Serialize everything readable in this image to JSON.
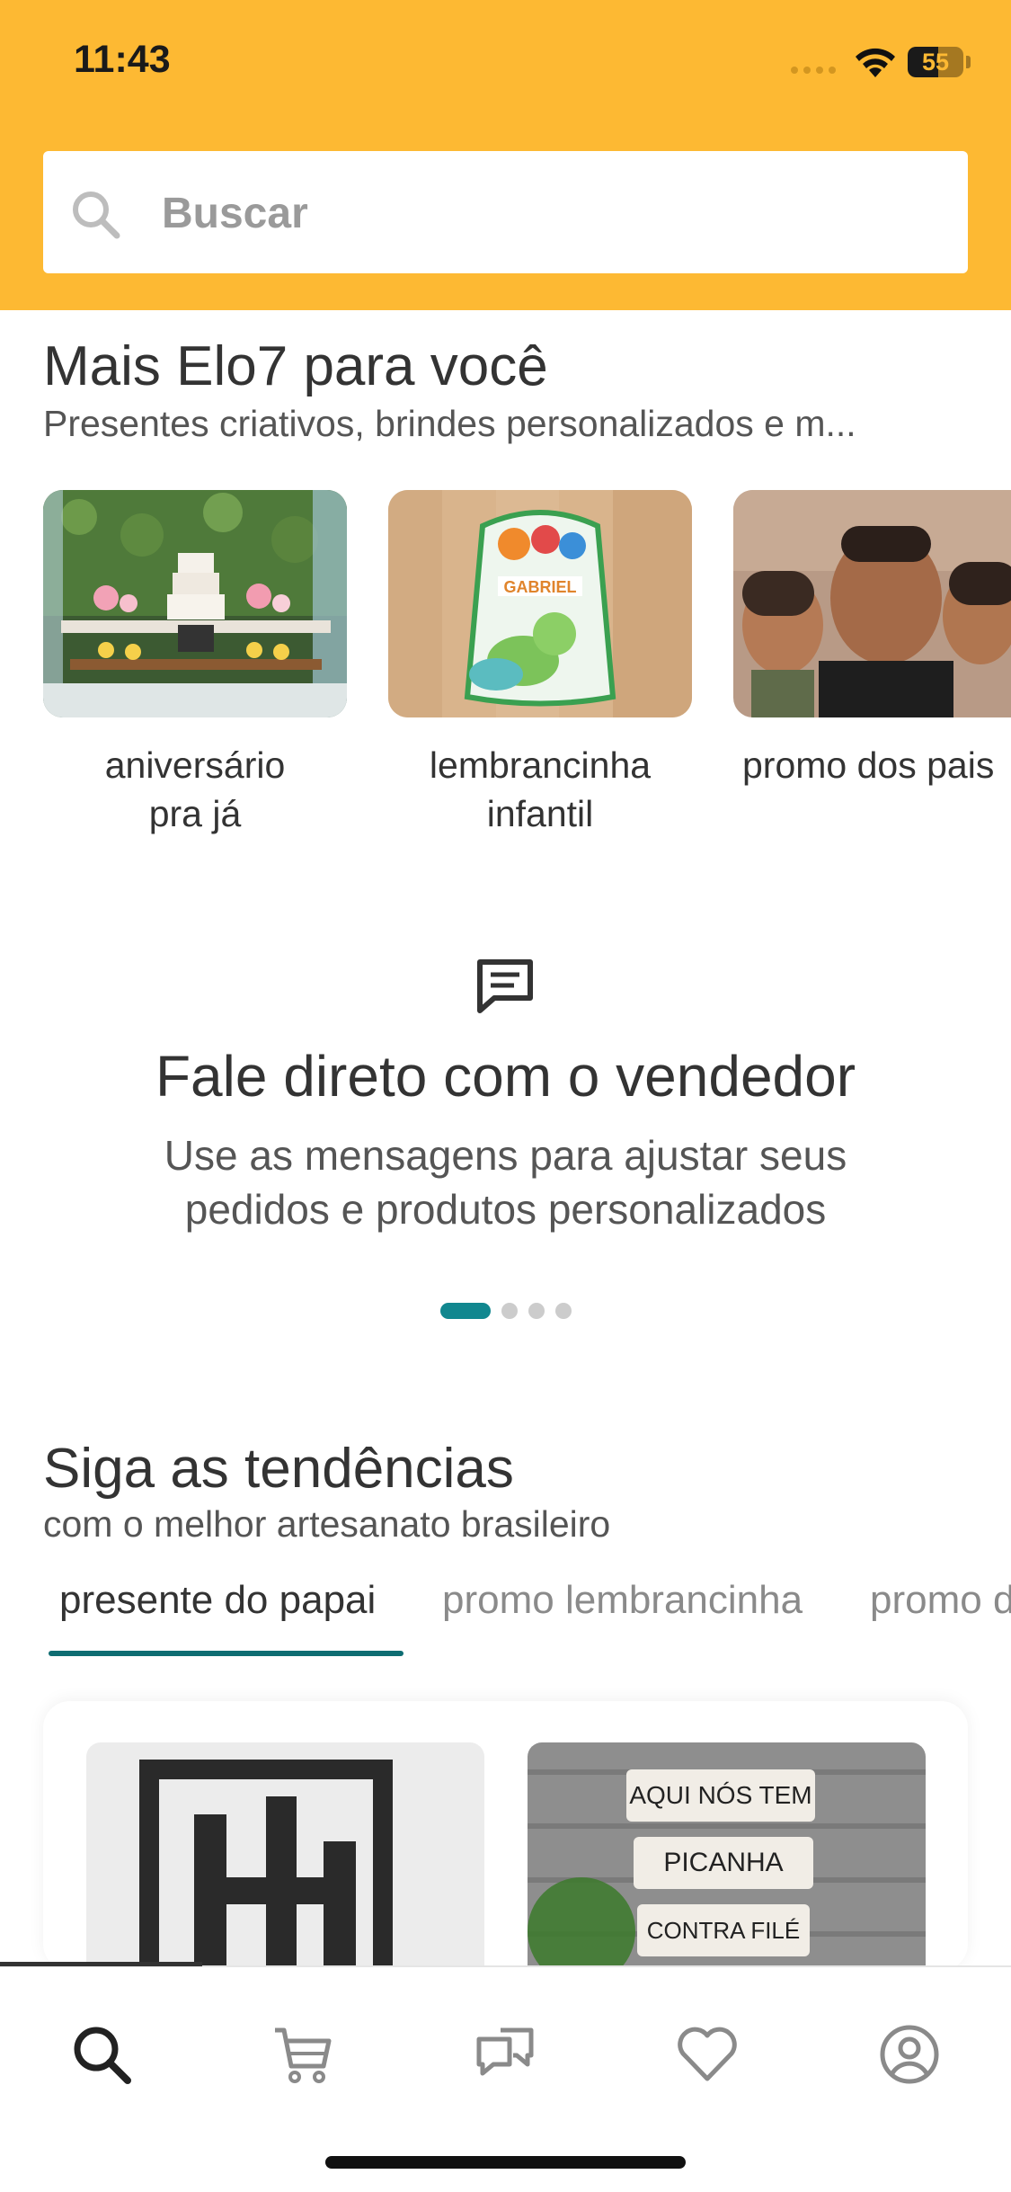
{
  "status_bar": {
    "time": "11:43",
    "battery": "55"
  },
  "search": {
    "placeholder": "Buscar"
  },
  "mais_elo7": {
    "title": "Mais Elo7 para você",
    "subtitle": "Presentes criativos, brindes personalizados e m...",
    "categories": [
      {
        "label_line1": "aniversário",
        "label_line2": "pra já"
      },
      {
        "label_line1": "lembrancinha",
        "label_line2": "infantil"
      },
      {
        "label_line1": "promo dos pais",
        "label_line2": ""
      }
    ],
    "bag_text": "GABRIEL"
  },
  "promo": {
    "title": "Fale direto com o vendedor",
    "line1": "Use as mensagens para ajustar seus",
    "line2": "pedidos e produtos personalizados",
    "dots_total": 4,
    "dots_active": 1
  },
  "tendencias": {
    "title": "Siga as tendências",
    "subtitle": "com o melhor artesanato brasileiro",
    "tabs": [
      "presente do papai",
      "promo lembrancinha",
      "promo d"
    ],
    "sign_texts": [
      "AQUI NÓS TEM",
      "PICANHA",
      "CONTRA FILÉ"
    ]
  },
  "bottom_nav": {
    "items": [
      "search-icon",
      "cart-icon",
      "messages-icon",
      "heart-icon",
      "profile-icon"
    ]
  },
  "colors": {
    "header": "#fdb933",
    "accent": "#11878f",
    "tab_underline": "#0f6d72"
  }
}
